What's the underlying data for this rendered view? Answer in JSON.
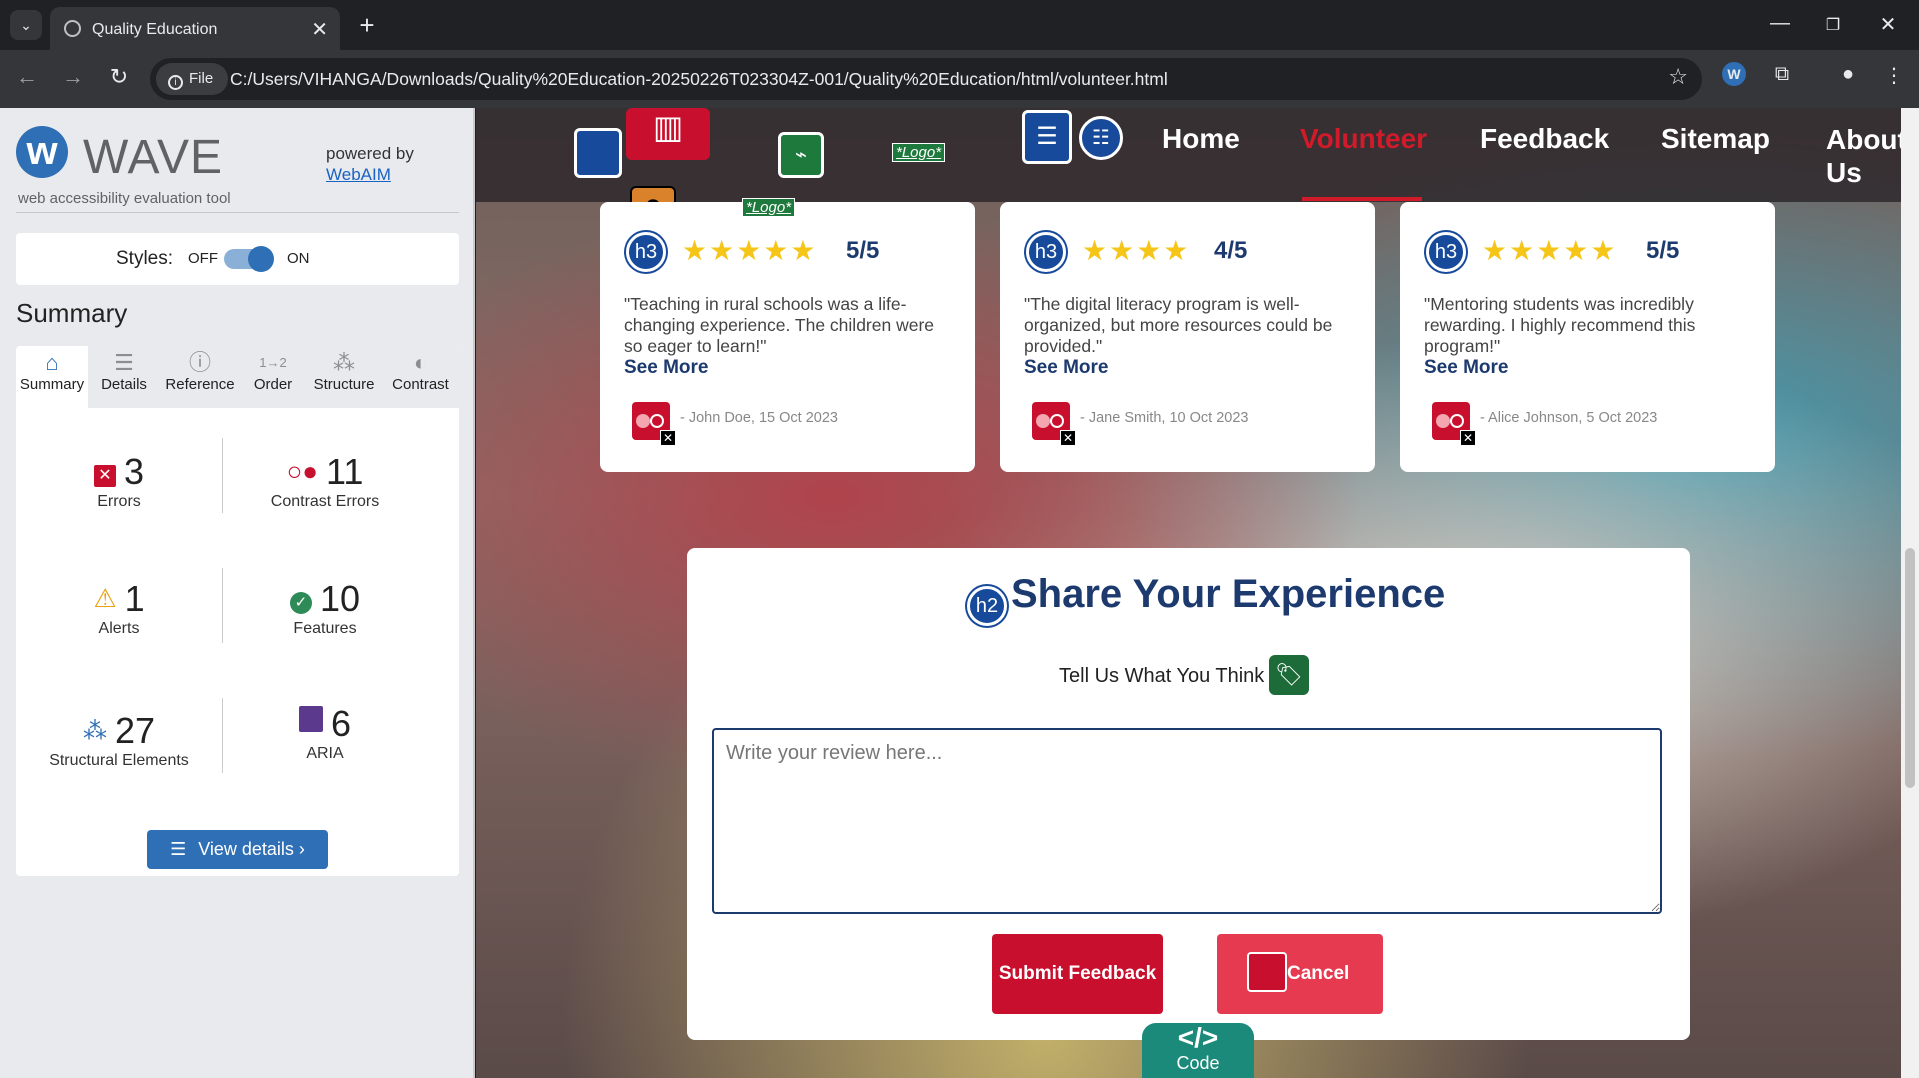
{
  "browser": {
    "tab_title": "Quality Education",
    "file_chip": "File",
    "url": "C:/Users/VIHANGA/Downloads/Quality%20Education-20250226T023304Z-001/Quality%20Education/html/volunteer.html"
  },
  "wave": {
    "name": "WAVE",
    "tagline": "web accessibility evaluation tool",
    "powered_by": "powered by",
    "webaim": "WebAIM",
    "styles_label": "Styles:",
    "styles_off": "OFF",
    "styles_on": "ON",
    "styles_state": "on",
    "summary_heading": "Summary",
    "tabs": [
      {
        "label": "Summary",
        "icon": "home-icon"
      },
      {
        "label": "Details",
        "icon": "list-icon"
      },
      {
        "label": "Reference",
        "icon": "info-icon"
      },
      {
        "label": "Order",
        "icon": "order-icon"
      },
      {
        "label": "Structure",
        "icon": "structure-icon"
      },
      {
        "label": "Contrast",
        "icon": "contrast-icon"
      }
    ],
    "metrics": {
      "errors": {
        "value": "3",
        "label": "Errors"
      },
      "contrast": {
        "value": "11",
        "label": "Contrast Errors"
      },
      "alerts": {
        "value": "1",
        "label": "Alerts"
      },
      "features": {
        "value": "10",
        "label": "Features"
      },
      "structural": {
        "value": "27",
        "label": "Structural Elements"
      },
      "aria": {
        "value": "6",
        "label": "ARIA"
      }
    },
    "view_details": "View details ›"
  },
  "site": {
    "nav": {
      "home": "Home",
      "volunteer": "Volunteer",
      "feedback": "Feedback",
      "sitemap": "Sitemap",
      "about": "About Us"
    },
    "logo_tag": "*Logo*",
    "reviews": [
      {
        "rating": "5/5",
        "stars": "★★★★★",
        "text": "\"Teaching in rural schools was a life-changing experience. The children were so eager to learn!\"",
        "see_more": "See More",
        "author": "- John Doe, 15 Oct 2023"
      },
      {
        "rating": "4/5",
        "stars": "★★★★",
        "text": "\"The digital literacy program is well-organized, but more resources could be provided.\"",
        "see_more": "See More",
        "author": "- Jane Smith, 10 Oct 2023"
      },
      {
        "rating": "5/5",
        "stars": "★★★★★",
        "text": "\"Mentoring students was incredibly rewarding. I highly recommend this program!\"",
        "see_more": "See More",
        "author": "- Alice Johnson, 5 Oct 2023"
      }
    ],
    "feedback": {
      "title": "Share Your Experience",
      "tell_us": "Tell Us What You Think",
      "placeholder": "Write your review here...",
      "submit": "Submit Feedback",
      "cancel": "Cancel"
    },
    "code_tab": {
      "symbol": "</>",
      "label": "Code"
    },
    "h3_badge": "h3",
    "h2_badge": "h2"
  },
  "colors": {
    "brand_red": "#c8102e",
    "navy": "#1d3a6e",
    "wave_blue": "#2f6fb5"
  }
}
